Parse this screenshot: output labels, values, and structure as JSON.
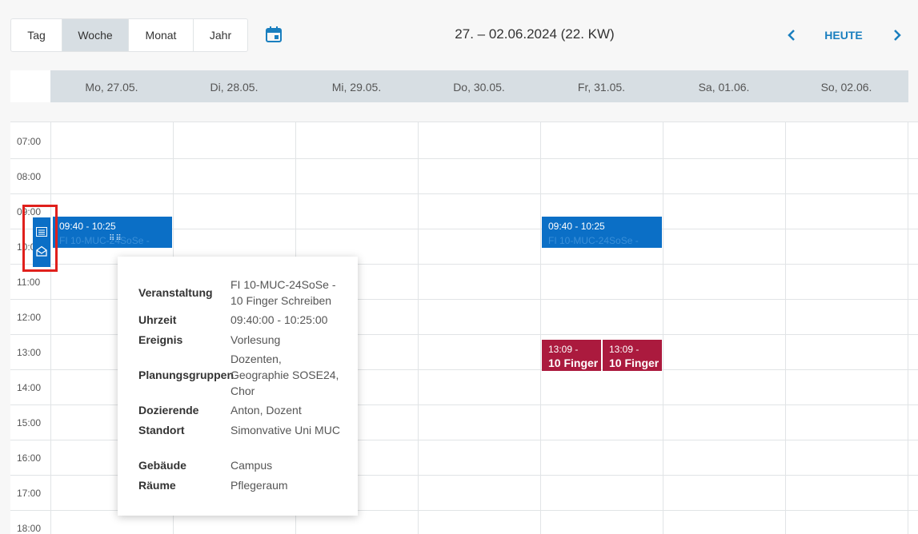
{
  "toolbar": {
    "views": [
      "Tag",
      "Woche",
      "Monat",
      "Jahr"
    ],
    "active_view": "Woche",
    "period_title": "27. – 02.06.2024 (22. KW)",
    "today_label": "HEUTE"
  },
  "colors": {
    "accent": "#1a7fbf",
    "event_blue": "#0b6fc6",
    "event_red": "#ab1a3e",
    "header_bg": "#d7dee3",
    "highlight": "#e0201c"
  },
  "days": [
    "Mo, 27.05.",
    "Di, 28.05.",
    "Mi, 29.05.",
    "Do, 30.05.",
    "Fr, 31.05.",
    "Sa, 01.06.",
    "So, 02.06."
  ],
  "times": [
    "07:00",
    "08:00",
    "09:00",
    "10:00",
    "11:00",
    "12:00",
    "13:00",
    "14:00",
    "15:00",
    "16:00",
    "17:00",
    "18:00"
  ],
  "events": [
    {
      "time": "09:40 - 10:25",
      "title": "FI 10-MUC-24SoSe -"
    },
    {
      "time": "09:40 - 10:25",
      "title": "FI 10-MUC-24SoSe -"
    },
    {
      "time": "13:09 -",
      "title": "10 Finger"
    },
    {
      "time": "13:09 -",
      "title": "10 Finger"
    }
  ],
  "event_actions": [
    "list-icon",
    "envelope-open-icon"
  ],
  "popup": {
    "rows": [
      {
        "label": "Veranstaltung",
        "value": "FI 10-MUC-24SoSe - 10 Finger Schreiben"
      },
      {
        "label": "Uhrzeit",
        "value": "09:40:00 - 10:25:00"
      },
      {
        "label": "Ereignis",
        "value": "Vorlesung"
      },
      {
        "label": "Planungsgruppen",
        "value": "Dozenten, Geographie SOSE24, Chor"
      },
      {
        "label": "Dozierende",
        "value": "Anton, Dozent"
      },
      {
        "label": "Standort",
        "value": "Simonvative Uni MUC"
      },
      {
        "label": "Gebäude",
        "value": "Campus"
      },
      {
        "label": "Räume",
        "value": "Pflegeraum"
      }
    ]
  }
}
